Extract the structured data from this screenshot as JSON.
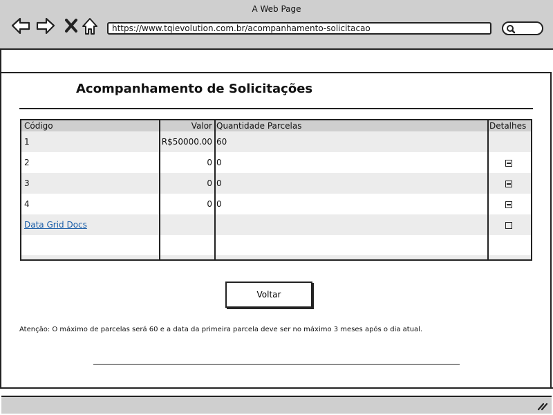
{
  "window": {
    "title": "A Web Page"
  },
  "browser": {
    "url": "https://www.tqievolution.com.br/acompanhamento-solicitacao",
    "icons": [
      "back-arrow-icon",
      "forward-arrow-icon",
      "close-icon",
      "home-icon",
      "search-icon",
      "resize-grip-icon"
    ]
  },
  "page": {
    "title": "Acompanhamento de Solicitações",
    "back_button": "Voltar",
    "note": "Atenção: O máximo de parcelas será 60 e a data da primeira parcela deve ser no máximo 3 meses após o dia atual."
  },
  "grid": {
    "headers": {
      "code": "Código",
      "value": "Valor",
      "installments": "Quantidade Parcelas",
      "details": "Detalhes"
    },
    "rows": [
      {
        "code": "1",
        "value": "R$50000.00",
        "installments": "60",
        "detail_icon": "none"
      },
      {
        "code": "2",
        "value": "0",
        "installments": "0",
        "detail_icon": "minus-square-icon"
      },
      {
        "code": "3",
        "value": "0",
        "installments": "0",
        "detail_icon": "minus-square-icon"
      },
      {
        "code": "4",
        "value": "0",
        "installments": "0",
        "detail_icon": "minus-square-icon"
      }
    ],
    "footer_link": "Data Grid Docs",
    "footer_detail_icon": "empty-square-icon"
  }
}
